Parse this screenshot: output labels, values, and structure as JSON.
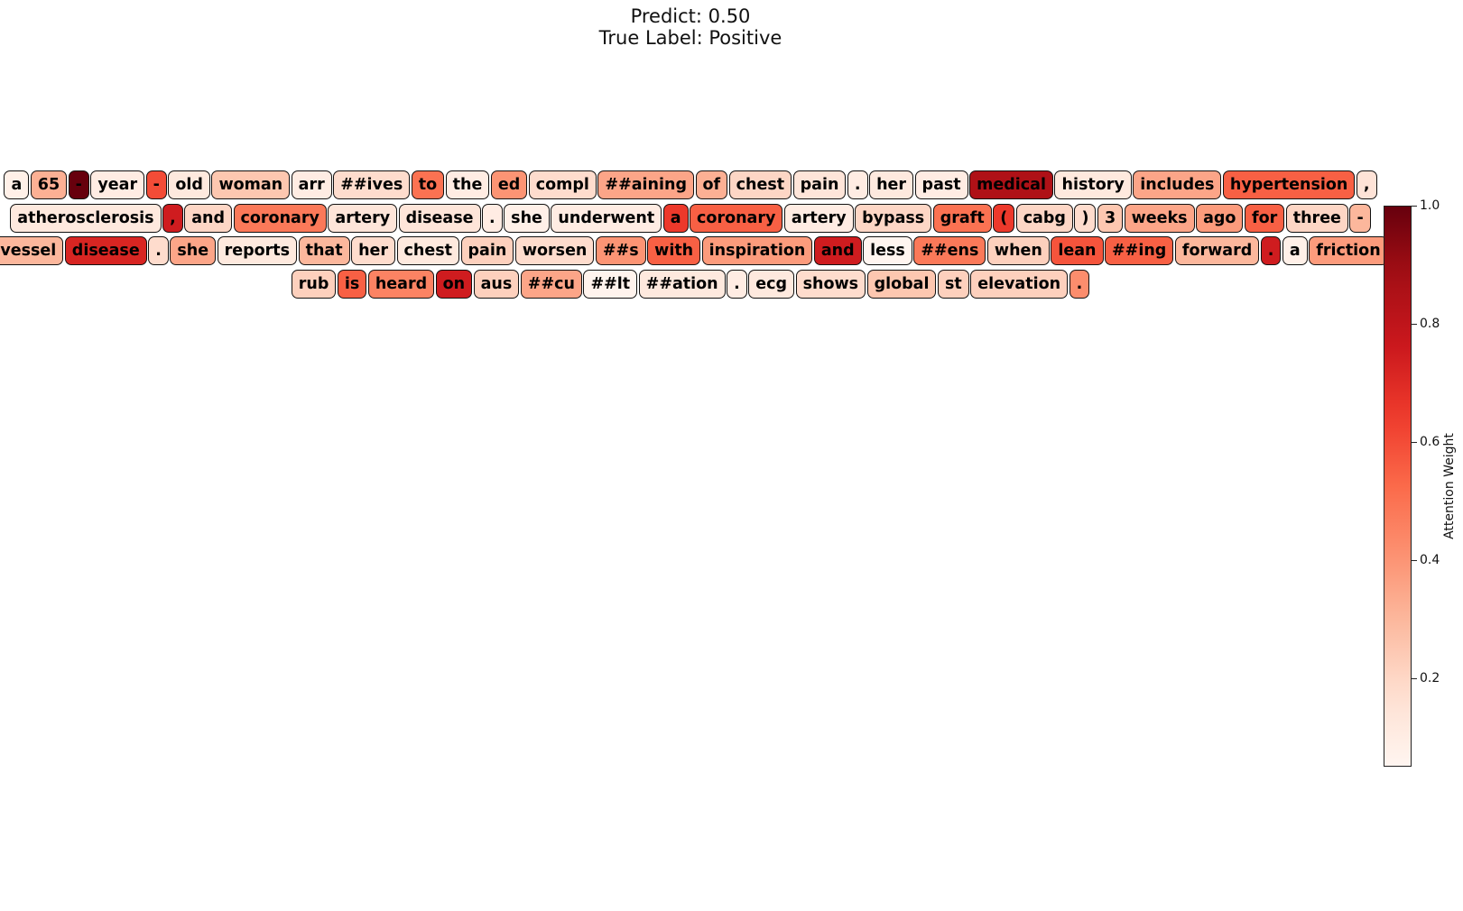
{
  "chart_data": {
    "type": "token-heatmap",
    "title": "Predict: 0.50",
    "subtitle": "True Label: Positive",
    "colorbar": {
      "label": "Attention Weight",
      "range": [
        0.05,
        1.0
      ],
      "ticks": [
        0.2,
        0.4,
        0.6,
        0.8,
        1.0
      ],
      "tick_labels": [
        "0.2",
        "0.4",
        "0.6",
        "0.8",
        "1.0"
      ],
      "colormap": "Reds"
    },
    "lines": [
      [
        {
          "text": "a",
          "w": 0.08
        },
        {
          "text": "65",
          "w": 0.32
        },
        {
          "text": "-",
          "w": 1.0
        },
        {
          "text": "year",
          "w": 0.1
        },
        {
          "text": "-",
          "w": 0.6
        },
        {
          "text": "old",
          "w": 0.12
        },
        {
          "text": "woman",
          "w": 0.25
        },
        {
          "text": "arr",
          "w": 0.1
        },
        {
          "text": "##ives",
          "w": 0.18
        },
        {
          "text": "to",
          "w": 0.5
        },
        {
          "text": "the",
          "w": 0.1
        },
        {
          "text": "ed",
          "w": 0.4
        },
        {
          "text": "compl",
          "w": 0.18
        },
        {
          "text": "##aining",
          "w": 0.35
        },
        {
          "text": "of",
          "w": 0.32
        },
        {
          "text": "chest",
          "w": 0.2
        },
        {
          "text": "pain",
          "w": 0.14
        },
        {
          "text": ".",
          "w": 0.1
        },
        {
          "text": "her",
          "w": 0.12
        },
        {
          "text": "past",
          "w": 0.1
        },
        {
          "text": "medical",
          "w": 0.85
        },
        {
          "text": "history",
          "w": 0.12
        },
        {
          "text": "includes",
          "w": 0.35
        },
        {
          "text": "hypertension",
          "w": 0.55
        },
        {
          "text": ",",
          "w": 0.15
        }
      ],
      [
        {
          "text": "atherosclerosis",
          "w": 0.12
        },
        {
          "text": ",",
          "w": 0.75
        },
        {
          "text": "and",
          "w": 0.2
        },
        {
          "text": "coronary",
          "w": 0.48
        },
        {
          "text": "artery",
          "w": 0.14
        },
        {
          "text": "disease",
          "w": 0.14
        },
        {
          "text": ".",
          "w": 0.1
        },
        {
          "text": "she",
          "w": 0.08
        },
        {
          "text": "underwent",
          "w": 0.1
        },
        {
          "text": "a",
          "w": 0.65
        },
        {
          "text": "coronary",
          "w": 0.55
        },
        {
          "text": "artery",
          "w": 0.1
        },
        {
          "text": "bypass",
          "w": 0.2
        },
        {
          "text": "graft",
          "w": 0.5
        },
        {
          "text": "(",
          "w": 0.65
        },
        {
          "text": "cabg",
          "w": 0.2
        },
        {
          "text": ")",
          "w": 0.18
        },
        {
          "text": "3",
          "w": 0.25
        },
        {
          "text": "weeks",
          "w": 0.35
        },
        {
          "text": "ago",
          "w": 0.38
        },
        {
          "text": "for",
          "w": 0.55
        },
        {
          "text": "three",
          "w": 0.2
        },
        {
          "text": "-",
          "w": 0.3
        }
      ],
      [
        {
          "text": "vessel",
          "w": 0.3
        },
        {
          "text": "disease",
          "w": 0.72
        },
        {
          "text": ".",
          "w": 0.18
        },
        {
          "text": "she",
          "w": 0.35
        },
        {
          "text": "reports",
          "w": 0.12
        },
        {
          "text": "that",
          "w": 0.3
        },
        {
          "text": "her",
          "w": 0.18
        },
        {
          "text": "chest",
          "w": 0.12
        },
        {
          "text": "pain",
          "w": 0.22
        },
        {
          "text": "worsen",
          "w": 0.18
        },
        {
          "text": "##s",
          "w": 0.4
        },
        {
          "text": "with",
          "w": 0.55
        },
        {
          "text": "inspiration",
          "w": 0.38
        },
        {
          "text": "and",
          "w": 0.75
        },
        {
          "text": "less",
          "w": 0.05
        },
        {
          "text": "##ens",
          "w": 0.48
        },
        {
          "text": "when",
          "w": 0.22
        },
        {
          "text": "lean",
          "w": 0.58
        },
        {
          "text": "##ing",
          "w": 0.55
        },
        {
          "text": "forward",
          "w": 0.3
        },
        {
          "text": ".",
          "w": 0.75
        },
        {
          "text": "a",
          "w": 0.08
        },
        {
          "text": "friction",
          "w": 0.38
        }
      ],
      [
        {
          "text": "rub",
          "w": 0.22
        },
        {
          "text": "is",
          "w": 0.55
        },
        {
          "text": "heard",
          "w": 0.45
        },
        {
          "text": "on",
          "w": 0.75
        },
        {
          "text": "aus",
          "w": 0.22
        },
        {
          "text": "##cu",
          "w": 0.35
        },
        {
          "text": "##lt",
          "w": 0.06
        },
        {
          "text": "##ation",
          "w": 0.12
        },
        {
          "text": ".",
          "w": 0.1
        },
        {
          "text": "ecg",
          "w": 0.12
        },
        {
          "text": "shows",
          "w": 0.18
        },
        {
          "text": "global",
          "w": 0.25
        },
        {
          "text": "st",
          "w": 0.22
        },
        {
          "text": "elevation",
          "w": 0.22
        },
        {
          "text": ".",
          "w": 0.42
        }
      ]
    ]
  }
}
